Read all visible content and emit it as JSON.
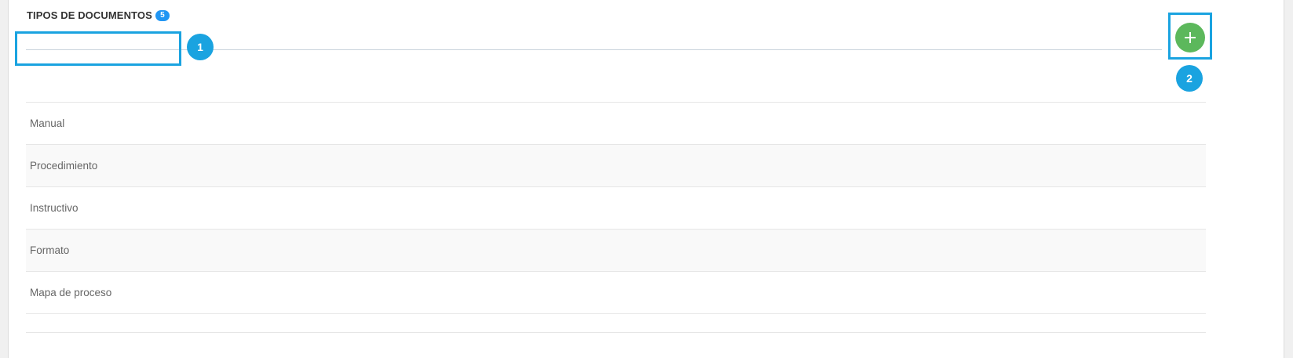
{
  "header": {
    "title": "TIPOS DE DOCUMENTOS",
    "count": "5"
  },
  "search": {
    "placeholder": ""
  },
  "add_button": {
    "icon": "plus-icon",
    "color": "#5cb85c"
  },
  "annotations": {
    "one": "1",
    "two": "2",
    "color": "#1aa3e0"
  },
  "document_types": [
    {
      "label": "Manual"
    },
    {
      "label": "Procedimiento"
    },
    {
      "label": "Instructivo"
    },
    {
      "label": "Formato"
    },
    {
      "label": "Mapa de proceso"
    }
  ]
}
